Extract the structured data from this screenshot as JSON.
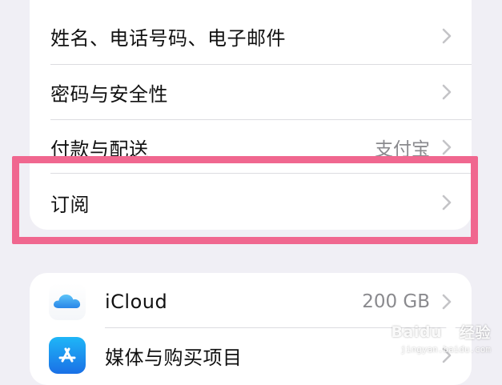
{
  "group1": {
    "rows": [
      {
        "label": "姓名、电话号码、电子邮件",
        "value": ""
      },
      {
        "label": "密码与安全性",
        "value": ""
      },
      {
        "label": "付款与配送",
        "value": "支付宝"
      },
      {
        "label": "订阅",
        "value": ""
      }
    ]
  },
  "group2": {
    "rows": [
      {
        "label": "iCloud",
        "value": "200 GB",
        "icon": "icloud-icon"
      },
      {
        "label": "媒体与购买项目",
        "value": "",
        "icon": "app-store-icon"
      }
    ]
  },
  "highlight": {
    "color": "#f0678f"
  },
  "watermark": {
    "brand": "Baidu",
    "brand_suffix": "经验",
    "url": "jingyan.baidu.com"
  }
}
